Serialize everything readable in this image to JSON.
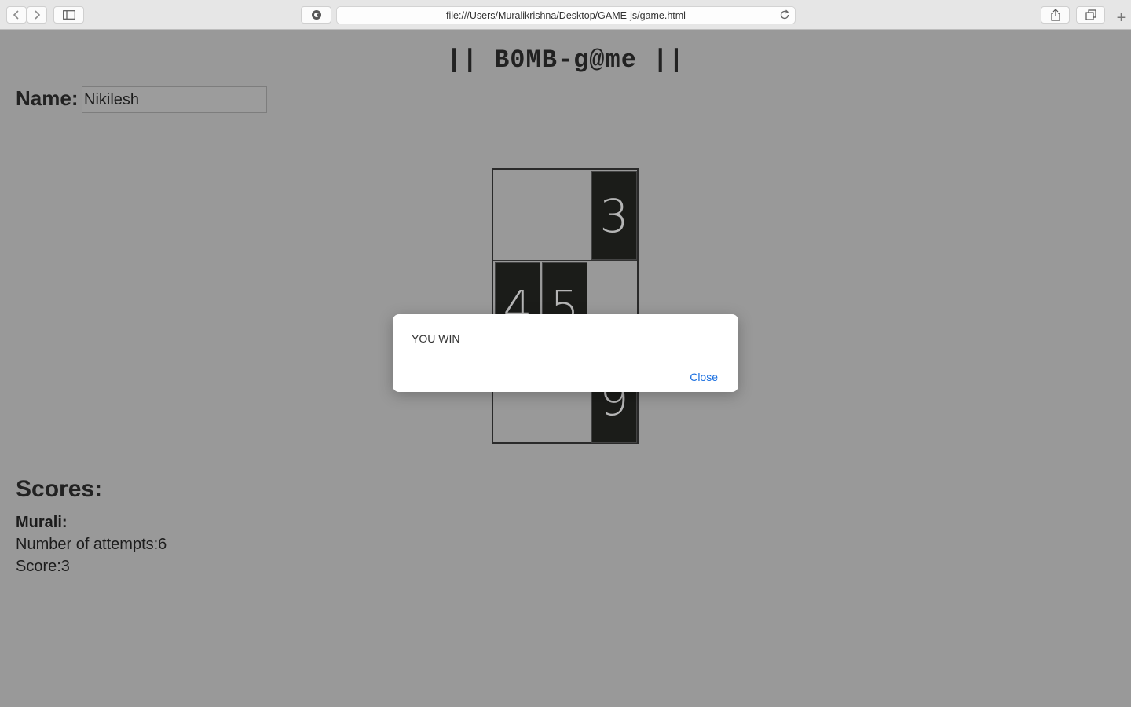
{
  "browser": {
    "url": "file:///Users/Muralikrishna/Desktop/GAME-js/game.html",
    "new_tab_symbol": "+"
  },
  "page": {
    "title": "|| B0MB-g@me ||",
    "name_label": "Name:",
    "name_value": "Nikilesh",
    "board": {
      "revealed": [
        "3",
        "4",
        "5",
        "9"
      ]
    },
    "scores_title": "Scores:",
    "scores": [
      {
        "player": "Murali:",
        "attempts": "Number of attempts:6",
        "score": "Score:3"
      }
    ]
  },
  "alert": {
    "message": "YOU WIN",
    "close_label": "Close"
  },
  "colors": {
    "page_bg": "#999999",
    "tile": "#1b1c19",
    "link": "#1a6fe0"
  }
}
